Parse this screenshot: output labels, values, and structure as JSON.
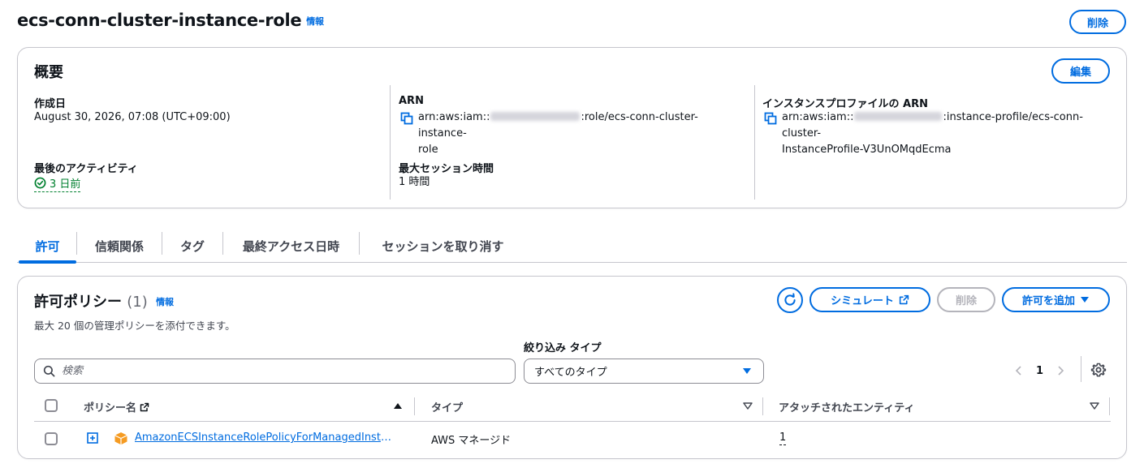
{
  "header": {
    "title": "ecs-conn-cluster-instance-role",
    "info_label": "情報",
    "delete_label": "削除"
  },
  "summary": {
    "title": "概要",
    "edit_label": "編集",
    "created_label": "作成日",
    "created_value": "August 30, 2026, 07:08 (UTC+09:00)",
    "last_activity_label": "最後のアクティビティ",
    "last_activity_value": "3 日前",
    "arn_label": "ARN",
    "arn_prefix": "arn:aws:iam::",
    "arn_suffix_line1": ":role/ecs-conn-cluster-instance-",
    "arn_suffix_line2": "role",
    "max_session_label": "最大セッション時間",
    "max_session_value": "1 時間",
    "instance_profile_label": "インスタンスプロファイルの ARN",
    "instance_profile_prefix": "arn:aws:iam::",
    "instance_profile_suffix_line1": ":instance-profile/ecs-conn-cluster-",
    "instance_profile_suffix_line2": "InstanceProfile-V3UnOMqdEcma"
  },
  "tabs": [
    {
      "label": "許可",
      "active": true
    },
    {
      "label": "信頼関係",
      "active": false
    },
    {
      "label": "タグ",
      "active": false
    },
    {
      "label": "最終アクセス日時",
      "active": false
    },
    {
      "label": "セッションを取り消す",
      "active": false
    }
  ],
  "policies": {
    "title": "許可ポリシー",
    "count": "(1)",
    "info_label": "情報",
    "description": "最大 20 個の管理ポリシーを添付できます。",
    "simulate_label": "シミュレート",
    "remove_label": "削除",
    "add_label": "許可を追加",
    "filter_label": "絞り込み タイプ",
    "search_placeholder": "検索",
    "type_selected": "すべてのタイプ",
    "page_number": "1",
    "columns": {
      "name": "ポリシー名",
      "type": "タイプ",
      "entities": "アタッチされたエンティティ"
    },
    "rows": [
      {
        "name": "AmazonECSInstanceRolePolicyForManagedInstances",
        "type": "AWS マネージド",
        "entities": "1"
      }
    ]
  },
  "colors": {
    "accent": "#006ce0",
    "success": "#00802f",
    "aws_managed_icon": "#f59b22",
    "border": "#c6c6cd"
  }
}
